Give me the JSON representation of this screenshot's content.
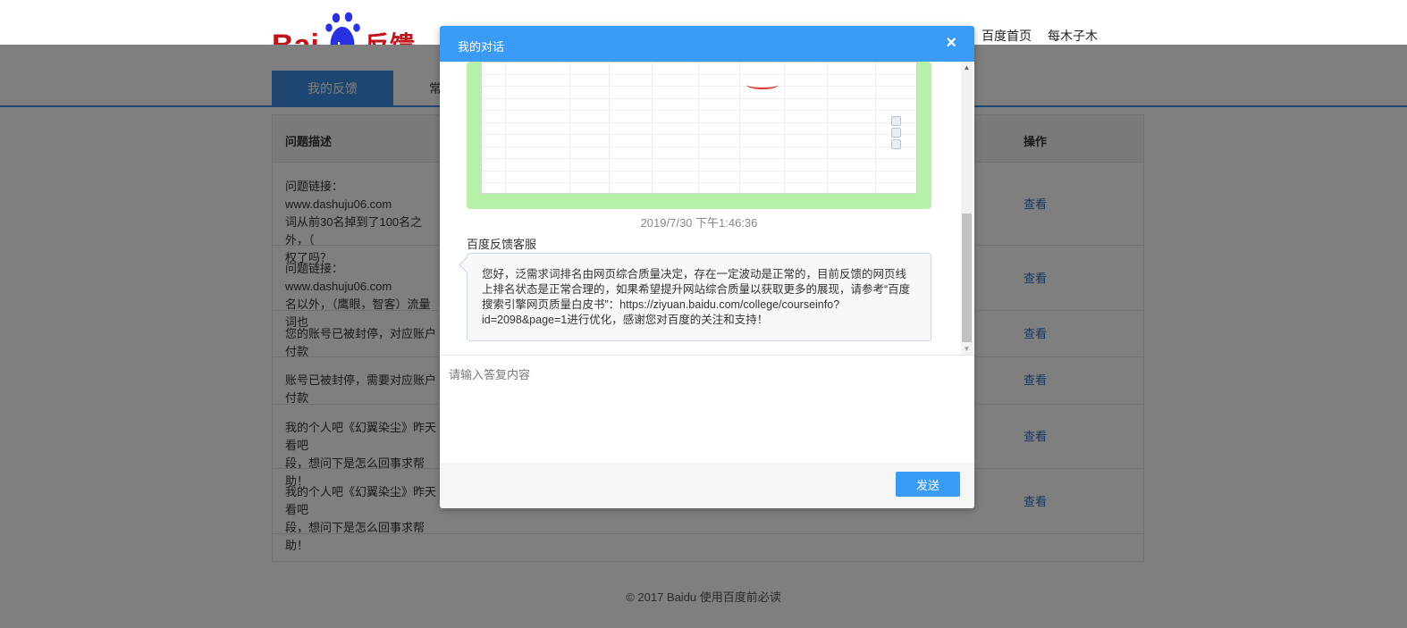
{
  "header": {
    "logo_text_bai": "Bai",
    "logo_text_du": "du",
    "logo_text_feedback": "反馈",
    "nav": [
      "百度首页",
      "每木子木"
    ]
  },
  "tabs": [
    {
      "label": "我的反馈",
      "active": true
    },
    {
      "label": "常",
      "active": false
    }
  ],
  "table": {
    "columns": {
      "description": "问题描述",
      "action": "操作"
    },
    "rows": [
      {
        "desc_lines": [
          "问题链接：www.dashuju06.com",
          "词从前30名掉到了100名之外，（",
          "权了吗？"
        ],
        "action": "查看"
      },
      {
        "desc_lines": [
          "问题链接：www.dashuju06.com",
          "名以外，（鹰眼，智客）流量词也"
        ],
        "action": "查看"
      },
      {
        "desc_lines": [
          "您的账号已被封停，对应账户付款"
        ],
        "action": "查看"
      },
      {
        "desc_lines": [
          "账号已被封停，需要对应账户付款"
        ],
        "action": "查看"
      },
      {
        "desc_lines": [
          "我的个人吧《幻翼染尘》昨天看吧",
          "段，想问下是怎么回事求帮助！"
        ],
        "action": "查看"
      },
      {
        "desc_lines": [
          "我的个人吧《幻翼染尘》昨天看吧",
          "段，想问下是怎么回事求帮助！"
        ],
        "action": "查看"
      }
    ]
  },
  "footer": {
    "copyright": "© 2017 Baidu",
    "link": "使用百度前必读"
  },
  "modal": {
    "title": "我的对话",
    "close_label": "×",
    "timestamp": "2019/7/30 下午1:46:36",
    "sender": "百度反馈客服",
    "message": "您好，泛需求词排名由网页综合质量决定，存在一定波动是正常的，目前反馈的网页线上排名状态是正常合理的，如果希望提升网站综合质量以获取更多的展现，请参考“百度搜索引擎网页质量白皮书”：https://ziyuan.baidu.com/college/courseinfo?id=2098&page=1进行优化，感谢您对百度的关注和支持！",
    "reply_placeholder": "请输入答复内容",
    "send_label": "发送"
  },
  "colors": {
    "brand_blue": "#3a9bf5",
    "logo_red": "#c0141c",
    "logo_blue": "#2932e1",
    "link_blue": "#2a6cc2"
  }
}
